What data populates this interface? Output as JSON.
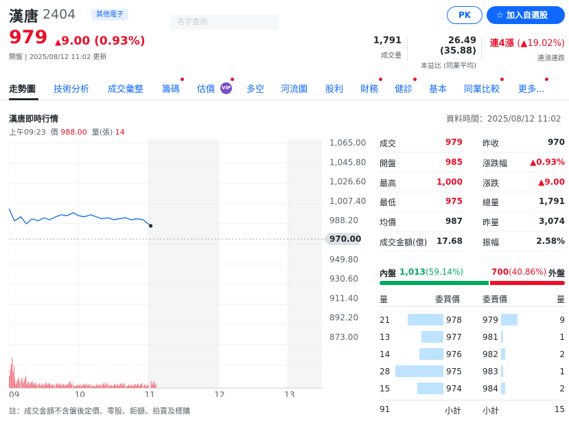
{
  "header": {
    "name": "漢唐",
    "code": "2404",
    "category": "其他電子",
    "ghost_text": "名字查詢",
    "pk_label": "PK",
    "add_label": "加入自選股",
    "price": "979",
    "change": "9.00 (0.93%)",
    "change_arrow": "▲",
    "updated_prefix": "開盤 | ",
    "updated_time": "2025/08/12 11:02",
    "updated_suffix": " 更新"
  },
  "stats": [
    {
      "value": "1,791",
      "label": "成交量"
    },
    {
      "value": "26.49 (35.88)",
      "label": "本益比 (同業平均)"
    },
    {
      "value_main": "連4漲",
      "value_pct": "(▲19.02%)",
      "label": "連漲連跌"
    }
  ],
  "tabs": [
    {
      "label": "走勢圖",
      "active": true,
      "dot": false
    },
    {
      "label": "技術分析",
      "dot": false
    },
    {
      "label": "成交彙整",
      "dot": false
    },
    {
      "label": "籌碼",
      "dot": true
    },
    {
      "label": "估價",
      "dot": true,
      "vip": "VIP"
    },
    {
      "label": "多空",
      "dot": false
    },
    {
      "label": "河流圖",
      "dot": false
    },
    {
      "label": "股利",
      "dot": false
    },
    {
      "label": "財務",
      "dot": true
    },
    {
      "label": "健診",
      "dot": true
    },
    {
      "label": "基本",
      "dot": false
    },
    {
      "label": "同業比較",
      "dot": true
    },
    {
      "label": "更多...",
      "dot": true
    }
  ],
  "section": {
    "title": "漢唐即時行情",
    "data_time": "資料時間：2025/08/12 11:02",
    "cursor_time": "上午09:23",
    "cursor_price_label": "價",
    "cursor_price": "988.00",
    "cursor_vol_label": "量(張)",
    "cursor_vol": "14"
  },
  "chart_data": {
    "type": "line",
    "reference_price": "970.00",
    "y_ticks": [
      "1,065.00",
      "1,045.80",
      "1,026.60",
      "1,007.40",
      "988.20",
      "970.00",
      "949.80",
      "930.60",
      "911.40",
      "892.20",
      "873.00"
    ],
    "x_ticks": [
      "09",
      "10",
      "11",
      "12",
      "13"
    ],
    "x_hours": [
      9,
      9.08,
      9.17,
      9.25,
      9.33,
      9.42,
      9.5,
      9.58,
      9.67,
      9.75,
      9.83,
      9.92,
      10,
      10.08,
      10.17,
      10.25,
      10.33,
      10.42,
      10.5,
      10.58,
      10.67,
      10.75,
      10.83,
      10.92,
      11.03
    ],
    "price": [
      1000,
      988,
      992,
      985,
      990,
      988,
      991,
      989,
      992,
      994,
      993,
      996,
      993,
      992,
      994,
      992,
      990,
      991,
      989,
      990,
      991,
      989,
      990,
      989,
      983
    ],
    "volume": [
      35,
      12,
      14,
      9,
      8,
      6,
      7,
      5,
      6,
      5,
      8,
      4,
      5,
      6,
      4,
      5,
      7,
      4,
      5,
      6,
      4,
      5,
      6,
      5,
      9
    ],
    "footnote": "註：成交金額不含盤後定價、零股、鉅額、拍賣及標購"
  },
  "quote": {
    "left": [
      {
        "label": "成交",
        "value": "979",
        "color": "red"
      },
      {
        "label": "開盤",
        "value": "985",
        "color": "red"
      },
      {
        "label": "最高",
        "value": "1,000",
        "color": "red"
      },
      {
        "label": "最低",
        "value": "975",
        "color": "red"
      },
      {
        "label": "均價",
        "value": "987",
        "color": "black"
      },
      {
        "label": "成交金額(億)",
        "value": "17.68",
        "color": "black"
      }
    ],
    "right": [
      {
        "label": "昨收",
        "value": "970",
        "color": "black"
      },
      {
        "label": "漲跌幅",
        "value": "▲0.93%",
        "color": "red"
      },
      {
        "label": "漲跌",
        "value": "▲9.00",
        "color": "red"
      },
      {
        "label": "總量",
        "value": "1,791",
        "color": "black"
      },
      {
        "label": "昨量",
        "value": "3,074",
        "color": "black"
      },
      {
        "label": "振幅",
        "value": "2.58%",
        "color": "black"
      }
    ]
  },
  "inout": {
    "inner_label": "內盤",
    "inner_value": "1,013",
    "inner_pct": "(59.14%)",
    "outer_value": "700",
    "outer_pct": "(40.86%)",
    "outer_label": "外盤",
    "inner_ratio": 0.5914
  },
  "orderbook": {
    "headers": {
      "qty": "量",
      "bid": "委買價",
      "ask": "委賣價",
      "qty2": "量"
    },
    "bids": [
      {
        "qty": "21",
        "price": "978",
        "fill": 0.75
      },
      {
        "qty": "13",
        "price": "977",
        "fill": 0.46
      },
      {
        "qty": "14",
        "price": "976",
        "fill": 0.5
      },
      {
        "qty": "28",
        "price": "975",
        "fill": 1.0
      },
      {
        "qty": "15",
        "price": "974",
        "fill": 0.54
      }
    ],
    "asks": [
      {
        "price": "979",
        "qty": "9",
        "fill": 0.34
      },
      {
        "price": "981",
        "qty": "1",
        "fill": 0.04
      },
      {
        "price": "982",
        "qty": "2",
        "fill": 0.08
      },
      {
        "price": "983",
        "qty": "1",
        "fill": 0.04
      },
      {
        "price": "984",
        "qty": "2",
        "fill": 0.08
      }
    ],
    "total_bid": "91",
    "subtotal_label": "小計",
    "subtotal_label2": "小計",
    "total_ask": "15"
  },
  "colors": {
    "up": "#eb0f29",
    "down": "#00ab5e",
    "accent": "#0f69ff",
    "line": "#1e70e8"
  }
}
